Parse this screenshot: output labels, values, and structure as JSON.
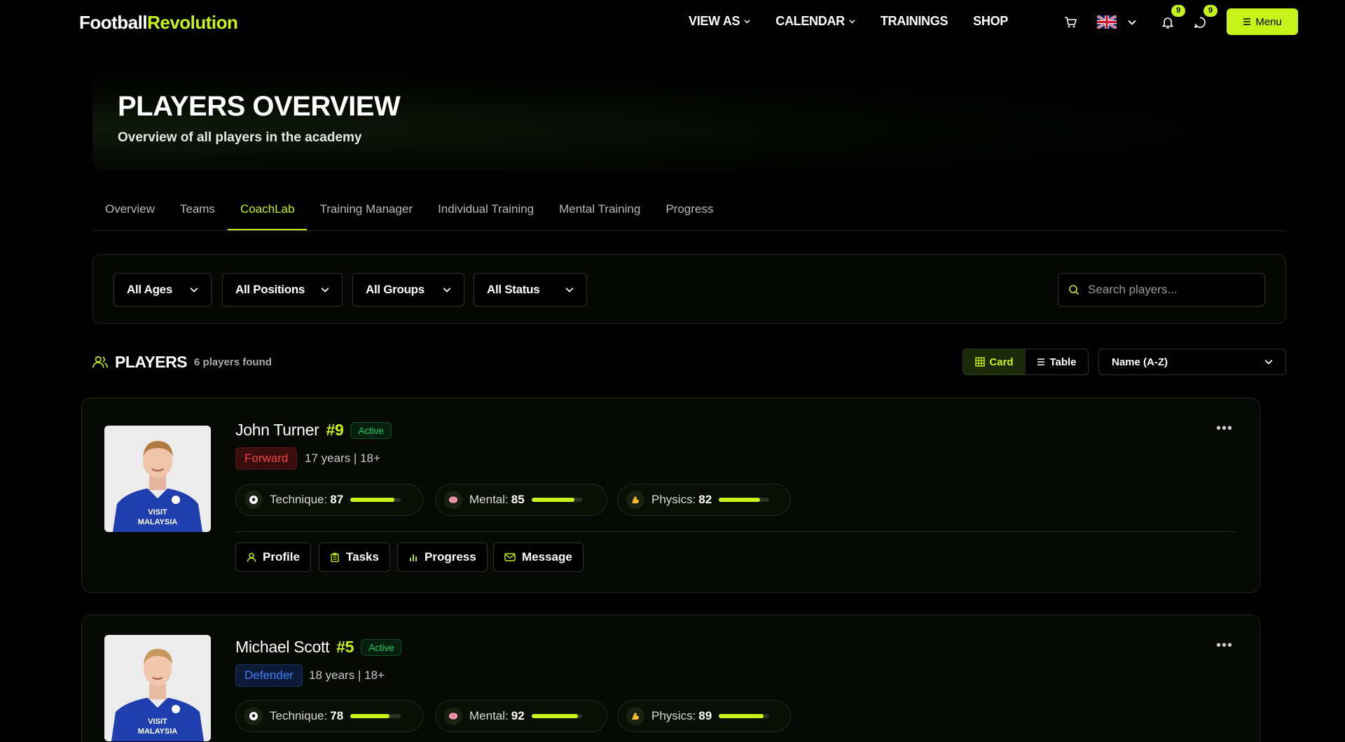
{
  "brand": {
    "part1": "Football",
    "part2": "Revolution"
  },
  "nav": {
    "links": [
      {
        "label": "VIEW AS",
        "has_dropdown": true
      },
      {
        "label": "CALENDAR",
        "has_dropdown": true
      },
      {
        "label": "TRAININGS",
        "has_dropdown": false
      },
      {
        "label": "SHOP",
        "has_dropdown": false
      }
    ],
    "notifications_count": "9",
    "messages_count": "9",
    "menu_label": "Menu",
    "language": "en-GB"
  },
  "hero": {
    "title": "PLAYERS OVERVIEW",
    "subtitle": "Overview of all players in the academy"
  },
  "tabs": [
    {
      "label": "Overview",
      "active": false
    },
    {
      "label": "Teams",
      "active": false
    },
    {
      "label": "CoachLab",
      "active": true
    },
    {
      "label": "Training Manager",
      "active": false
    },
    {
      "label": "Individual Training",
      "active": false
    },
    {
      "label": "Mental Training",
      "active": false
    },
    {
      "label": "Progress",
      "active": false
    }
  ],
  "filters": {
    "age": "All Ages",
    "position": "All Positions",
    "group": "All Groups",
    "status": "All Status",
    "search_placeholder": "Search players..."
  },
  "players_header": {
    "title": "PLAYERS",
    "count": "6 players found",
    "view_card": "Card",
    "view_table": "Table",
    "active_view": "Card",
    "sort": "Name (A-Z)"
  },
  "actions": {
    "profile": "Profile",
    "tasks": "Tasks",
    "progress": "Progress",
    "message": "Message"
  },
  "players": [
    {
      "name": "John Turner",
      "number": "#9",
      "status": "Active",
      "position": "Forward",
      "age": "17 years | 18+",
      "technique_label": "Technique:",
      "technique": 87,
      "mental_label": "Mental:",
      "mental": 85,
      "physics_label": "Physics:",
      "physics": 82,
      "shirt_text_1": "VISIT",
      "shirt_text_2": "MALAYSIA"
    },
    {
      "name": "Michael Scott",
      "number": "#5",
      "status": "Active",
      "position": "Defender",
      "age": "18 years | 18+",
      "technique_label": "Technique:",
      "technique": 78,
      "mental_label": "Mental:",
      "mental": 92,
      "physics_label": "Physics:",
      "physics": 89,
      "shirt_text_1": "VISIT",
      "shirt_text_2": "MALAYSIA"
    }
  ],
  "colors": {
    "accent": "#c7f21a",
    "forward": "#ef4444",
    "defender": "#3b82f6",
    "active": "#22c55e"
  }
}
